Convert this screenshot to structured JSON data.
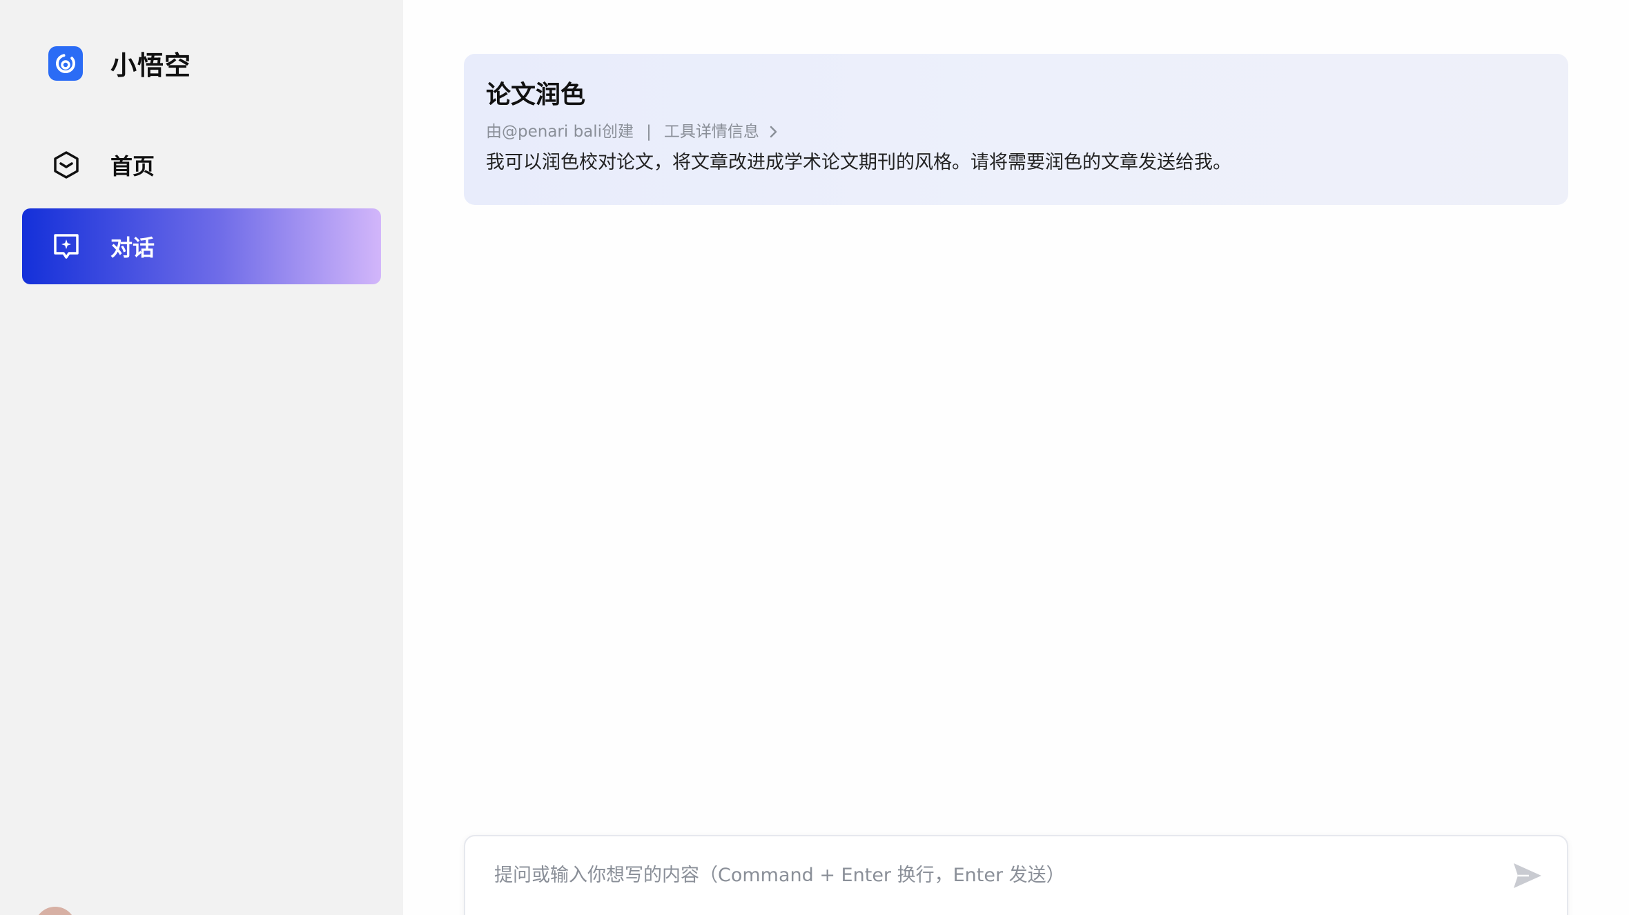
{
  "brand": {
    "name": "小悟空",
    "logo_color": "#2b6cf5"
  },
  "nav": {
    "home_label": "首页",
    "chat_label": "对话"
  },
  "tool": {
    "title": "论文润色",
    "creator": "由@penari bali创建",
    "separator": "|",
    "details_link": "工具详情信息",
    "description": "我可以润色校对论文，将文章改进成学术论文期刊的风格。请将需要润色的文章发送给我。"
  },
  "composer": {
    "placeholder": "提问或输入你想写的内容（Command + Enter 换行，Enter 发送）"
  },
  "colors": {
    "accent_gradient_start": "#1430d9",
    "accent_gradient_end": "#d2b6fa"
  }
}
